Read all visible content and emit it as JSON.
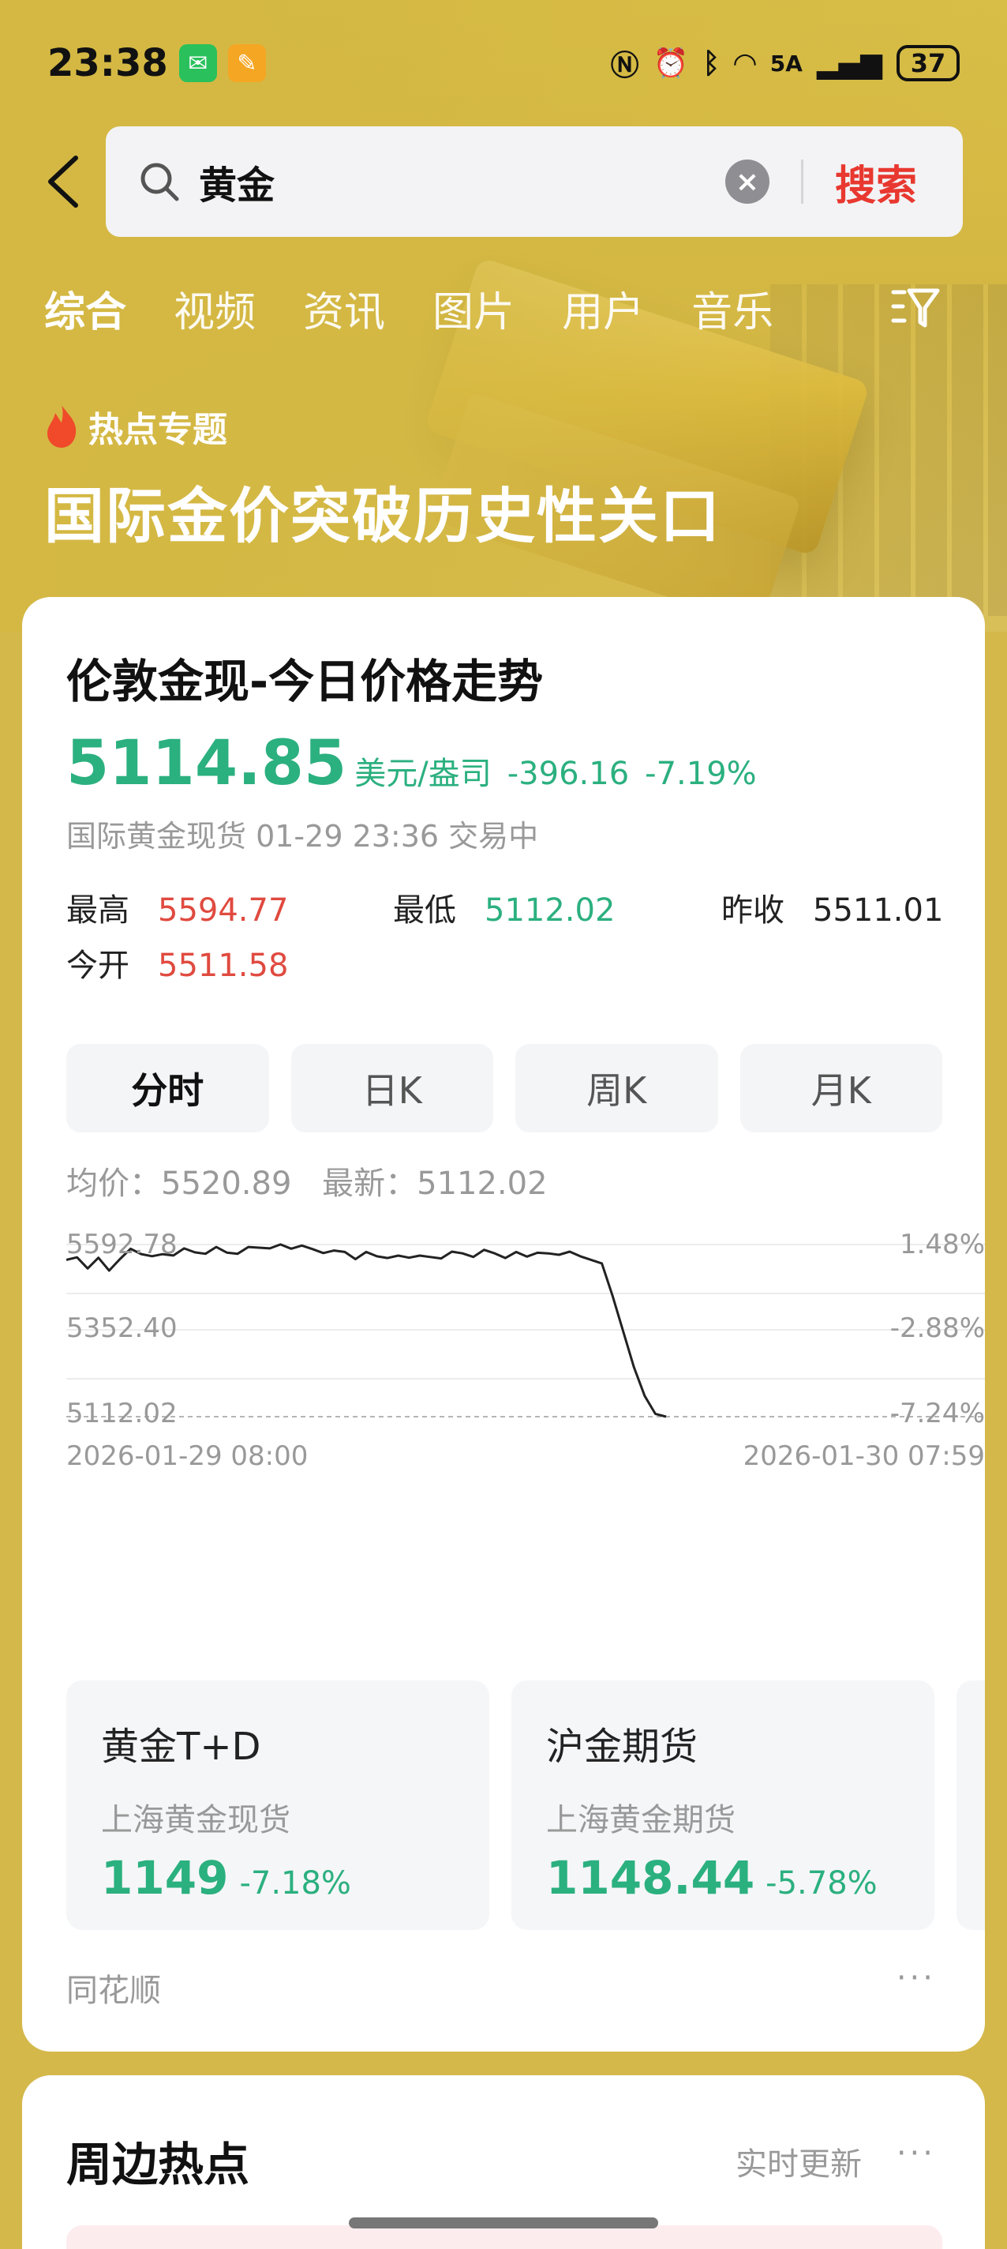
{
  "status_bar": {
    "time": "23:38",
    "battery": "37",
    "network": "5A"
  },
  "search": {
    "query": "黄金",
    "search_label": "搜索"
  },
  "tabs": [
    "综合",
    "视频",
    "资讯",
    "图片",
    "用户",
    "音乐"
  ],
  "hot_topic": {
    "label": "热点专题",
    "title": "国际金价突破历史性关口"
  },
  "main_card": {
    "title": "伦敦金现-今日价格走势",
    "price": "5114.85",
    "unit": "美元/盎司",
    "change": "-396.16",
    "change_pct": "-7.19%",
    "sub_info": "国际黄金现货 01-29 23:36 交易中",
    "stats": {
      "high_label": "最高",
      "high_value": "5594.77",
      "low_label": "最低",
      "low_value": "5112.02",
      "prev_close_label": "昨收",
      "prev_close_value": "5511.01",
      "open_label": "今开",
      "open_value": "5511.58"
    },
    "period_tabs": [
      "分时",
      "日K",
      "周K",
      "月K"
    ],
    "avg_label": "均价：5520.89",
    "latest_label": "最新：5112.02",
    "source": "同花顺",
    "more": "···"
  },
  "chart_data": {
    "type": "line",
    "y_left_ticks": [
      "5592.78",
      "5352.40",
      "5112.02"
    ],
    "y_right_ticks": [
      "1.48%",
      "-2.88%",
      "-7.24%"
    ],
    "x_ticks": [
      "2026-01-29 08:00",
      "2026-01-30 07:59"
    ],
    "ylim": [
      5112.02,
      5592.78
    ],
    "series": [
      {
        "values": [
          5540,
          5555,
          5532,
          5548,
          5520,
          5560,
          5575,
          5568,
          5570,
          5562,
          5566,
          5572,
          5569,
          5573,
          5578,
          5570,
          5575,
          5580,
          5586,
          5592,
          5589,
          5585,
          5580,
          5578,
          5575,
          5568,
          5572,
          5560,
          5566,
          5562,
          5565,
          5558,
          5560,
          5552,
          5556,
          5560,
          5565,
          5568,
          5566,
          5572,
          5570,
          5565,
          5568,
          5563,
          5560,
          5566,
          5570,
          5565,
          5560,
          5558,
          5540,
          5450,
          5350,
          5250,
          5170,
          5120,
          5112
        ]
      }
    ]
  },
  "sub_cards": [
    {
      "title": "黄金T+D",
      "subtitle": "上海黄金现货",
      "price": "1149",
      "pct": "-7.18%"
    },
    {
      "title": "沪金期货",
      "subtitle": "上海黄金期货",
      "price": "1148.44",
      "pct": "-5.78%"
    }
  ],
  "second_card": {
    "title": "周边热点",
    "right_label": "实时更新",
    "more": "···"
  }
}
